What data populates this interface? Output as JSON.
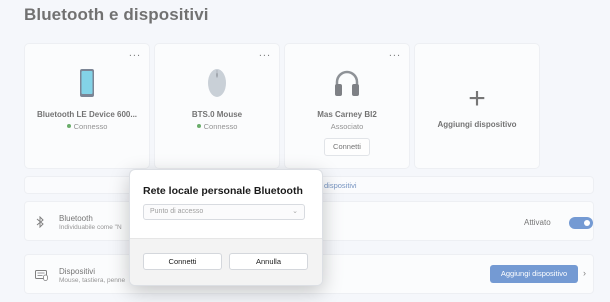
{
  "page": {
    "title": "Bluetooth e dispositivi"
  },
  "device_cards": [
    {
      "name": "Bluetooth LE Device 600...",
      "status": "Connesso",
      "icon": "phone-icon",
      "more": "..."
    },
    {
      "name": "BTS.0 Mouse",
      "status": "Connesso",
      "icon": "mouse-icon",
      "more": "..."
    },
    {
      "name": "Mas Carney BI2",
      "status": "Associato",
      "icon": "headphones-icon",
      "more": "...",
      "connect_label": "Connetti"
    }
  ],
  "add_card": {
    "label": "Aggiungi dispositivo",
    "icon": "plus-icon"
  },
  "strip": {
    "link_text": "dispositivi"
  },
  "bluetooth_row": {
    "title": "Bluetooth",
    "subtitle": "Individuabile come \"N",
    "state_label": "Attivato",
    "toggle_on": true
  },
  "devices_row": {
    "title": "Dispositivi",
    "subtitle": "Mouse, tastiera, penne",
    "button_label": "Aggiungi dispositivo"
  },
  "dialog": {
    "title": "Rete locale personale Bluetooth",
    "select_placeholder": "Punto di accesso",
    "ok_label": "Connetti",
    "cancel_label": "Annulla"
  },
  "colors": {
    "accent": "#1f5db8",
    "status_green": "#0f7b0f",
    "background": "#eff3f9"
  }
}
